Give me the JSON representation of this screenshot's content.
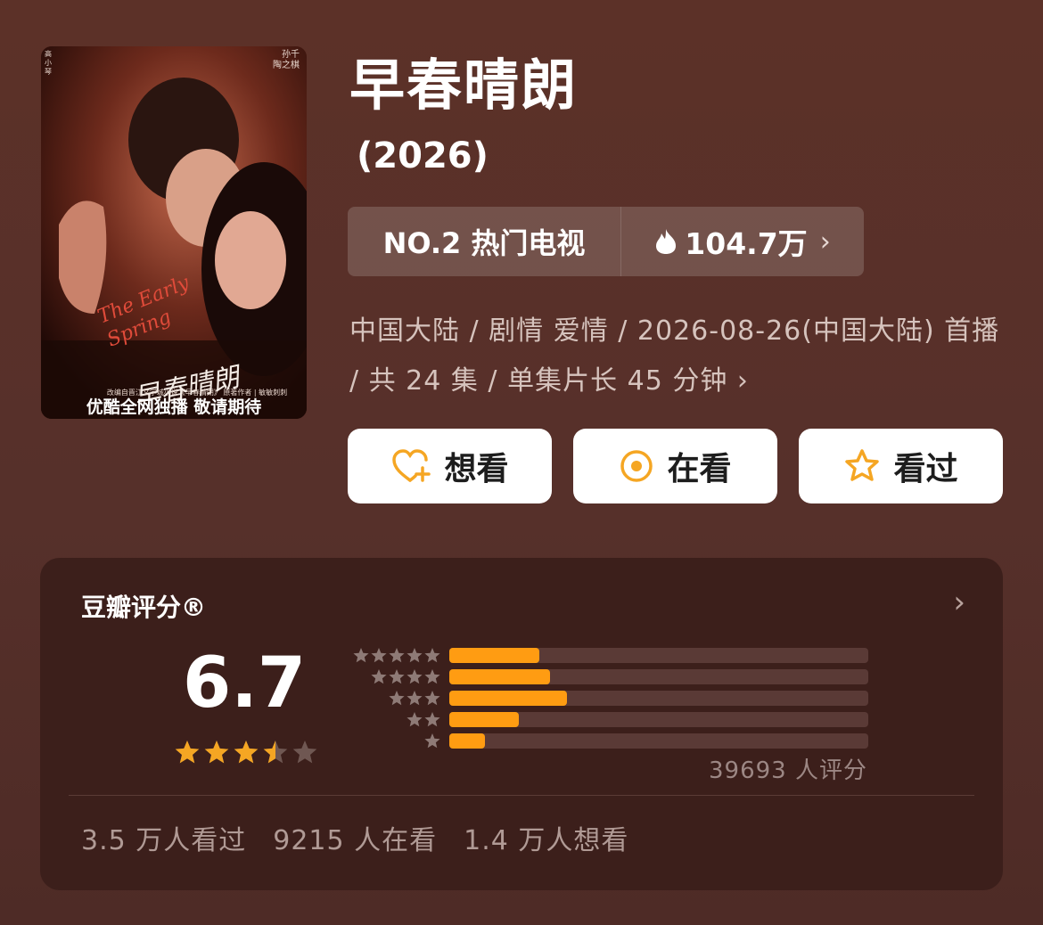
{
  "poster": {
    "english_title": "The Early Spring",
    "calligraphy_title": "早春晴朗",
    "tagline": "优酷全网独播 敬请期待",
    "note": "改编自晋江文学城小说《早春晴朗》 原著作者 | 敏敏刺刺",
    "credits_right": "孙千",
    "credits_right_sub": "陶之棋",
    "credits_left": "高小琴"
  },
  "title": "早春晴朗",
  "year": "(2026)",
  "rank": {
    "label": "NO.2 热门电视",
    "heat": "104.7万",
    "chevron": "›"
  },
  "meta": {
    "text": "中国大陆 / 剧情 爱情 / 2026-08-26(中国大陆) 首播 / 共 24 集 / 单集片长 45 分钟",
    "chevron": "›"
  },
  "actions": {
    "want": "想看",
    "watching": "在看",
    "watched": "看过"
  },
  "rating": {
    "title": "豆瓣评分®",
    "chevron": "›",
    "score": "6.7",
    "stars_value": 3.5,
    "stars_max": 5,
    "count_text": "39693 人评分",
    "distribution": [
      {
        "stars": 5,
        "fraction": 0.215
      },
      {
        "stars": 4,
        "fraction": 0.24
      },
      {
        "stars": 3,
        "fraction": 0.28
      },
      {
        "stars": 2,
        "fraction": 0.165
      },
      {
        "stars": 1,
        "fraction": 0.085
      }
    ]
  },
  "stats": {
    "watched": "3.5 万人看过",
    "watching": "9215 人在看",
    "want": "1.4 万人想看"
  },
  "colors": {
    "accent": "#ff9c12",
    "star": "#f5a623",
    "background": "#5a2f27",
    "card": "#3c1f1b"
  }
}
